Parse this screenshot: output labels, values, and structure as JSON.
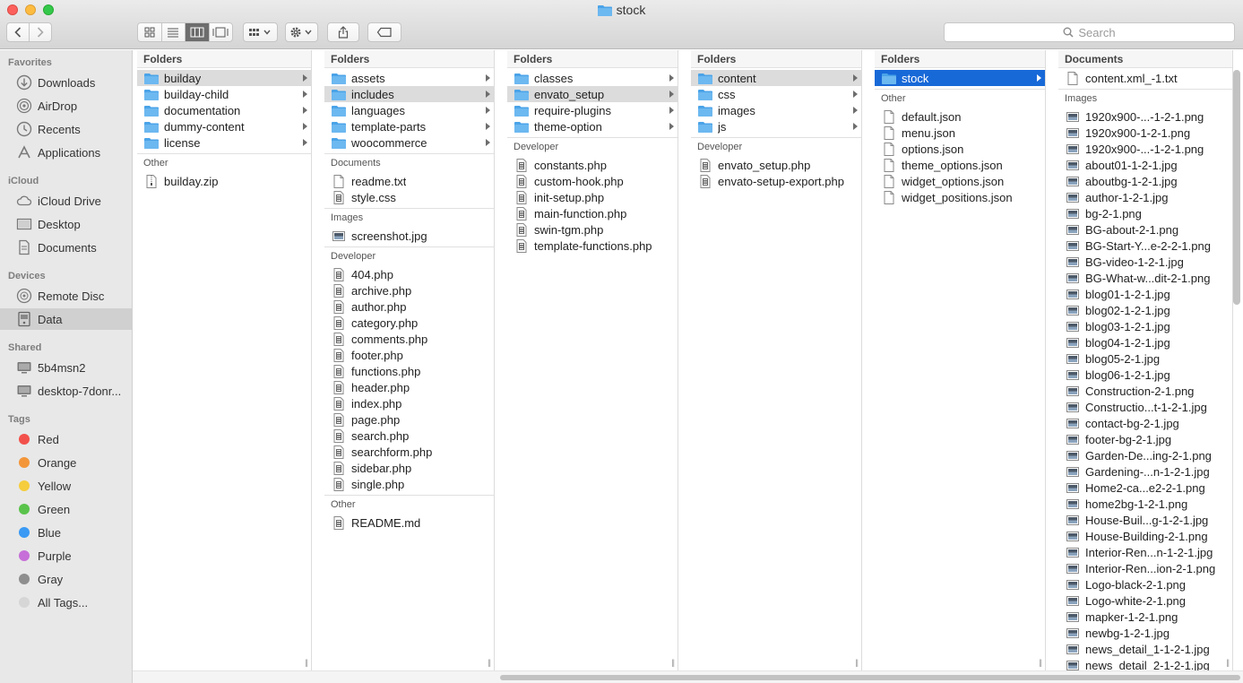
{
  "window": {
    "title": "stock"
  },
  "toolbar": {
    "search_placeholder": "Search",
    "colors": {
      "active_view": "#6d6d6d"
    }
  },
  "sidebar": {
    "sections": [
      {
        "title": "Favorites",
        "items": [
          {
            "label": "Downloads",
            "icon": "download-icon"
          },
          {
            "label": "AirDrop",
            "icon": "airdrop-icon"
          },
          {
            "label": "Recents",
            "icon": "recents-icon"
          },
          {
            "label": "Applications",
            "icon": "applications-icon"
          }
        ]
      },
      {
        "title": "iCloud",
        "items": [
          {
            "label": "iCloud Drive",
            "icon": "cloud-icon"
          },
          {
            "label": "Desktop",
            "icon": "desktop-icon"
          },
          {
            "label": "Documents",
            "icon": "documents-icon"
          }
        ]
      },
      {
        "title": "Devices",
        "items": [
          {
            "label": "Remote Disc",
            "icon": "disc-icon"
          },
          {
            "label": "Data",
            "icon": "drive-icon",
            "selected": true
          }
        ]
      },
      {
        "title": "Shared",
        "items": [
          {
            "label": "5b4msn2",
            "icon": "computer-icon"
          },
          {
            "label": "desktop-7donr...",
            "icon": "computer-icon"
          }
        ]
      },
      {
        "title": "Tags",
        "items": [
          {
            "label": "Red",
            "color": "#f2514b"
          },
          {
            "label": "Orange",
            "color": "#f3963a"
          },
          {
            "label": "Yellow",
            "color": "#f5cd3d"
          },
          {
            "label": "Green",
            "color": "#5ac34b"
          },
          {
            "label": "Blue",
            "color": "#3a9af4"
          },
          {
            "label": "Purple",
            "color": "#c66fd8"
          },
          {
            "label": "Gray",
            "color": "#8e8e8e"
          },
          {
            "label": "All Tags...",
            "color": "#d6d6d6"
          }
        ]
      }
    ]
  },
  "columns": [
    {
      "sections": [
        {
          "title": "Folders",
          "items": [
            {
              "label": "builday",
              "type": "folder",
              "selected": true
            },
            {
              "label": "builday-child",
              "type": "folder"
            },
            {
              "label": "documentation",
              "type": "folder"
            },
            {
              "label": "dummy-content",
              "type": "folder"
            },
            {
              "label": "license",
              "type": "folder"
            }
          ]
        },
        {
          "title": "Other",
          "items": [
            {
              "label": "builday.zip",
              "type": "zip"
            }
          ]
        }
      ]
    },
    {
      "sections": [
        {
          "title": "Folders",
          "items": [
            {
              "label": "assets",
              "type": "folder"
            },
            {
              "label": "includes",
              "type": "folder",
              "selected": true
            },
            {
              "label": "languages",
              "type": "folder"
            },
            {
              "label": "template-parts",
              "type": "folder"
            },
            {
              "label": "woocommerce",
              "type": "folder"
            }
          ]
        },
        {
          "title": "Documents",
          "items": [
            {
              "label": "readme.txt",
              "type": "doc"
            },
            {
              "label": "style.css",
              "type": "code"
            }
          ]
        },
        {
          "title": "Images",
          "items": [
            {
              "label": "screenshot.jpg",
              "type": "image"
            }
          ]
        },
        {
          "title": "Developer",
          "items": [
            {
              "label": "404.php",
              "type": "code"
            },
            {
              "label": "archive.php",
              "type": "code"
            },
            {
              "label": "author.php",
              "type": "code"
            },
            {
              "label": "category.php",
              "type": "code"
            },
            {
              "label": "comments.php",
              "type": "code"
            },
            {
              "label": "footer.php",
              "type": "code"
            },
            {
              "label": "functions.php",
              "type": "code"
            },
            {
              "label": "header.php",
              "type": "code"
            },
            {
              "label": "index.php",
              "type": "code"
            },
            {
              "label": "page.php",
              "type": "code"
            },
            {
              "label": "search.php",
              "type": "code"
            },
            {
              "label": "searchform.php",
              "type": "code"
            },
            {
              "label": "sidebar.php",
              "type": "code"
            },
            {
              "label": "single.php",
              "type": "code"
            }
          ]
        },
        {
          "title": "Other",
          "items": [
            {
              "label": "README.md",
              "type": "code"
            }
          ]
        }
      ]
    },
    {
      "sections": [
        {
          "title": "Folders",
          "items": [
            {
              "label": "classes",
              "type": "folder"
            },
            {
              "label": "envato_setup",
              "type": "folder",
              "selected": true
            },
            {
              "label": "require-plugins",
              "type": "folder"
            },
            {
              "label": "theme-option",
              "type": "folder"
            }
          ]
        },
        {
          "title": "Developer",
          "items": [
            {
              "label": "constants.php",
              "type": "code"
            },
            {
              "label": "custom-hook.php",
              "type": "code"
            },
            {
              "label": "init-setup.php",
              "type": "code"
            },
            {
              "label": "main-function.php",
              "type": "code"
            },
            {
              "label": "swin-tgm.php",
              "type": "code"
            },
            {
              "label": "template-functions.php",
              "type": "code"
            }
          ]
        }
      ]
    },
    {
      "sections": [
        {
          "title": "Folders",
          "items": [
            {
              "label": "content",
              "type": "folder",
              "selected": true
            },
            {
              "label": "css",
              "type": "folder"
            },
            {
              "label": "images",
              "type": "folder"
            },
            {
              "label": "js",
              "type": "folder"
            }
          ]
        },
        {
          "title": "Developer",
          "items": [
            {
              "label": "envato_setup.php",
              "type": "code"
            },
            {
              "label": "envato-setup-export.php",
              "type": "code"
            }
          ]
        }
      ]
    },
    {
      "sections": [
        {
          "title": "Folders",
          "items": [
            {
              "label": "stock",
              "type": "folder",
              "selected_blue": true
            }
          ]
        },
        {
          "title": "Other",
          "items": [
            {
              "label": "default.json",
              "type": "doc"
            },
            {
              "label": "menu.json",
              "type": "doc"
            },
            {
              "label": "options.json",
              "type": "doc"
            },
            {
              "label": "theme_options.json",
              "type": "doc"
            },
            {
              "label": "widget_options.json",
              "type": "doc"
            },
            {
              "label": "widget_positions.json",
              "type": "doc"
            }
          ]
        }
      ]
    },
    {
      "sections": [
        {
          "title": "Documents",
          "items": [
            {
              "label": "content.xml_-1.txt",
              "type": "doc"
            }
          ]
        },
        {
          "title": "Images",
          "items": [
            {
              "label": "1920x900-...-1-2-1.png",
              "type": "image"
            },
            {
              "label": "1920x900-1-2-1.png",
              "type": "image"
            },
            {
              "label": "1920x900-...-1-2-1.png",
              "type": "image"
            },
            {
              "label": "about01-1-2-1.jpg",
              "type": "image"
            },
            {
              "label": "aboutbg-1-2-1.jpg",
              "type": "image"
            },
            {
              "label": "author-1-2-1.jpg",
              "type": "image"
            },
            {
              "label": "bg-2-1.png",
              "type": "image"
            },
            {
              "label": "BG-about-2-1.png",
              "type": "image"
            },
            {
              "label": "BG-Start-Y...e-2-2-1.png",
              "type": "image"
            },
            {
              "label": "BG-video-1-2-1.jpg",
              "type": "image"
            },
            {
              "label": "BG-What-w...dit-2-1.png",
              "type": "image"
            },
            {
              "label": "blog01-1-2-1.jpg",
              "type": "image"
            },
            {
              "label": "blog02-1-2-1.jpg",
              "type": "image"
            },
            {
              "label": "blog03-1-2-1.jpg",
              "type": "image"
            },
            {
              "label": "blog04-1-2-1.jpg",
              "type": "image"
            },
            {
              "label": "blog05-2-1.jpg",
              "type": "image"
            },
            {
              "label": "blog06-1-2-1.jpg",
              "type": "image"
            },
            {
              "label": "Construction-2-1.png",
              "type": "image"
            },
            {
              "label": "Constructio...t-1-2-1.jpg",
              "type": "image"
            },
            {
              "label": "contact-bg-2-1.jpg",
              "type": "image"
            },
            {
              "label": "footer-bg-2-1.jpg",
              "type": "image"
            },
            {
              "label": "Garden-De...ing-2-1.png",
              "type": "image"
            },
            {
              "label": "Gardening-...n-1-2-1.jpg",
              "type": "image"
            },
            {
              "label": "Home2-ca...e2-2-1.png",
              "type": "image"
            },
            {
              "label": "home2bg-1-2-1.png",
              "type": "image"
            },
            {
              "label": "House-Buil...g-1-2-1.jpg",
              "type": "image"
            },
            {
              "label": "House-Building-2-1.png",
              "type": "image"
            },
            {
              "label": "Interior-Ren...n-1-2-1.jpg",
              "type": "image"
            },
            {
              "label": "Interior-Ren...ion-2-1.png",
              "type": "image"
            },
            {
              "label": "Logo-black-2-1.png",
              "type": "image"
            },
            {
              "label": "Logo-white-2-1.png",
              "type": "image"
            },
            {
              "label": "mapker-1-2-1.png",
              "type": "image"
            },
            {
              "label": "newbg-1-2-1.jpg",
              "type": "image"
            },
            {
              "label": "news_detail_1-1-2-1.jpg",
              "type": "image"
            },
            {
              "label": "news_detail_2-1-2-1.jpg",
              "type": "image"
            }
          ]
        }
      ]
    }
  ]
}
